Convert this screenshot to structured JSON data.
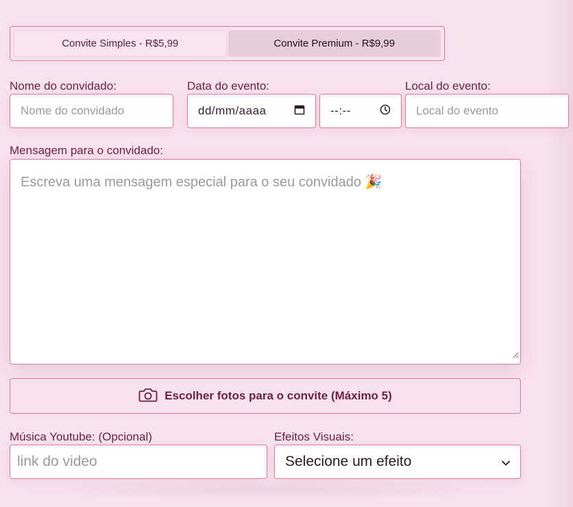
{
  "plans": {
    "simple_label": "Convite Simples - R$5,99",
    "premium_label": "Convite Premium - R$9,99"
  },
  "guest": {
    "label": "Nome do convidado:",
    "placeholder": "Nome do convidado"
  },
  "event_date": {
    "label": "Data do evento:",
    "date_placeholder": "dd/mm/aaaa",
    "time_placeholder": "--:--"
  },
  "location": {
    "label": "Local do evento:",
    "placeholder": "Local do evento"
  },
  "message": {
    "label": "Mensagem para o convidado:",
    "placeholder": "Escreva uma mensagem especial para o seu convidado 🎉"
  },
  "photos": {
    "button_label": "Escolher fotos para o convite (Máximo 5)"
  },
  "music": {
    "label": "Música Youtube: (Opcional)",
    "placeholder": "link do video"
  },
  "effects": {
    "label": "Efeitos Visuais:",
    "selected": "Selecione um efeito"
  },
  "colors": {
    "background": "#f8e1ee",
    "accent_border": "#e07a8e",
    "text": "#6b2340",
    "active_tab": "#e8ccdc"
  }
}
